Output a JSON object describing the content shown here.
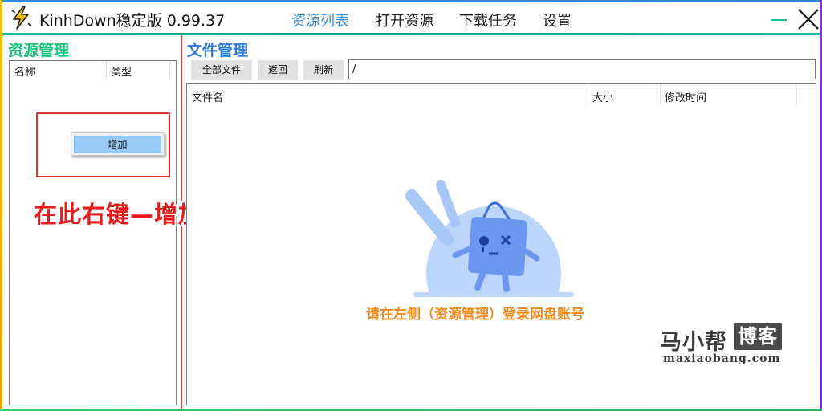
{
  "window": {
    "title": "KinhDown稳定版 0.99.37",
    "logo_icon": "lightning-bolt-icon",
    "minimize_icon": "minimize-icon",
    "close_icon": "close-icon",
    "colors": {
      "accent_tab": "#3a8fd8",
      "divider": "#1abc9c",
      "frame_left": "#f0b400",
      "frame_right": "#7b2cd6"
    }
  },
  "top_tabs": [
    {
      "label": "资源列表",
      "active": true
    },
    {
      "label": "打开资源",
      "active": false
    },
    {
      "label": "下载任务",
      "active": false
    },
    {
      "label": "设置",
      "active": false
    }
  ],
  "left_panel": {
    "header": "资源管理",
    "columns": [
      "名称",
      "类型"
    ],
    "context_menu": {
      "items": [
        "增加"
      ],
      "highlighted": "增加"
    },
    "instruction": "在此右键—增加—登录"
  },
  "right_panel": {
    "header": "文件管理",
    "buttons": [
      "全部文件",
      "返回",
      "刷新"
    ],
    "path": "/",
    "columns": [
      "文件名",
      "大小",
      "修改时间"
    ],
    "empty_icon": "confused-bag-mascot-icon",
    "empty_message": "请在左侧（资源管理）登录网盘账号"
  },
  "watermark": {
    "cn": "马小帮",
    "badge": "博客",
    "en": "maxiaobang.com"
  }
}
